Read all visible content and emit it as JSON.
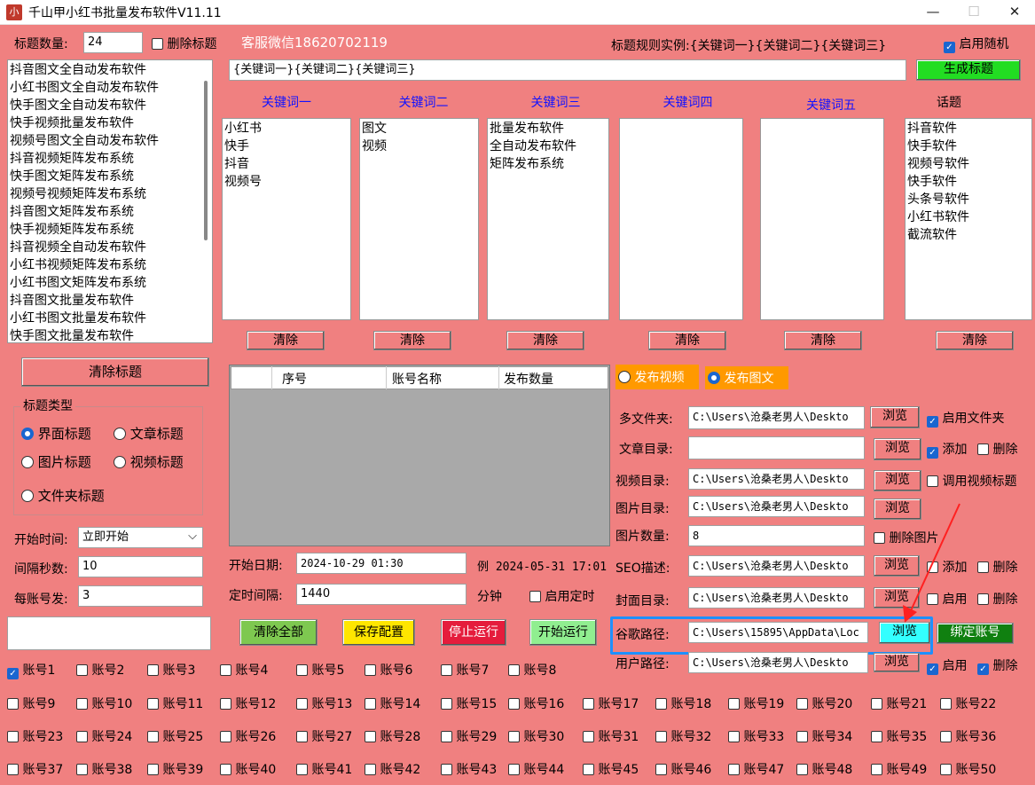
{
  "window": {
    "app_icon": "小",
    "title": "千山甲小红书批量发布软件V11.11"
  },
  "top": {
    "title_count_label": "标题数量:",
    "title_count_value": "24",
    "delete_title_label": "删除标题",
    "service_text": "客服微信18620702119",
    "rule_example": "标题规则实例:{关键词一}{关键词二}{关键词三}",
    "enable_random_label": "启用随机"
  },
  "title_list": [
    "抖音图文全自动发布软件",
    "小红书图文全自动发布软件",
    "快手图文全自动发布软件",
    "快手视频批量发布软件",
    "视频号图文全自动发布软件",
    "抖音视频矩阵发布系统",
    "快手图文矩阵发布系统",
    "视频号视频矩阵发布系统",
    "抖音图文矩阵发布系统",
    "快手视频矩阵发布系统",
    "抖音视频全自动发布软件",
    "小红书视频矩阵发布系统",
    "小红书图文矩阵发布系统",
    "抖音图文批量发布软件",
    "小红书图文批量发布软件",
    "快手图文批量发布软件"
  ],
  "template_input": "{关键词一}{关键词二}{关键词三}",
  "generate_button": "生成标题",
  "keywords": [
    {
      "header": "关键词一",
      "items": [
        "小红书",
        "快手",
        "抖音",
        "视频号"
      ],
      "clear": "清除"
    },
    {
      "header": "关键词二",
      "items": [
        "图文",
        "视频"
      ],
      "clear": "清除"
    },
    {
      "header": "关键词三",
      "items": [
        "批量发布软件",
        "全自动发布软件",
        "矩阵发布系统"
      ],
      "clear": "清除"
    },
    {
      "header": "关键词四",
      "items": [],
      "clear": "清除"
    },
    {
      "header": "关键词五",
      "items": [],
      "clear": "清除"
    },
    {
      "header": "话题",
      "items": [
        "抖音软件",
        "快手软件",
        "视频号软件",
        "快手软件",
        "头条号软件",
        "小红书软件",
        "截流软件"
      ],
      "clear": "清除"
    }
  ],
  "clear_titles_button": "清除标题",
  "title_type": {
    "legend": "标题类型",
    "options": [
      {
        "label": "界面标题",
        "selected": true
      },
      {
        "label": "文章标题",
        "selected": false
      },
      {
        "label": "图片标题",
        "selected": false
      },
      {
        "label": "视频标题",
        "selected": false
      },
      {
        "label": "文件夹标题",
        "selected": false
      }
    ]
  },
  "schedule": {
    "start_time_label": "开始时间:",
    "start_time_value": "立即开始",
    "interval_label": "间隔秒数:",
    "interval_value": "10",
    "per_account_label": "每账号发:",
    "per_account_value": "3"
  },
  "table": {
    "columns": [
      "",
      "序号",
      "账号名称",
      "发布数量"
    ]
  },
  "dates": {
    "start_date_label": "开始日期:",
    "start_date_value": "2024-10-29 01:30",
    "example": "例 2024-05-31 17:01",
    "timer_label": "定时间隔:",
    "timer_value": "1440",
    "minutes_label": "分钟",
    "enable_timer_label": "启用定时"
  },
  "actions": {
    "clear_all": "清除全部",
    "save_config": "保存配置",
    "stop": "停止运行",
    "start": "开始运行"
  },
  "publish_mode": {
    "video": "发布视频",
    "image": "发布图文",
    "selected": "image"
  },
  "paths": {
    "multi_folder_label": "多文件夹:",
    "multi_folder_value": "C:\\Users\\沧桑老男人\\Deskto",
    "enable_folder_label": "启用文件夹",
    "article_dir_label": "文章目录:",
    "article_dir_value": "",
    "add_label": "添加",
    "delete_label": "删除",
    "video_dir_label": "视频目录:",
    "video_dir_value": "C:\\Users\\沧桑老男人\\Deskto",
    "use_video_title_label": "调用视频标题",
    "image_dir_label": "图片目录:",
    "image_dir_value": "C:\\Users\\沧桑老男人\\Deskto",
    "image_count_label": "图片数量:",
    "image_count_value": "8",
    "delete_image_label": "删除图片",
    "seo_label": "SEO描述:",
    "seo_value": "C:\\Users\\沧桑老男人\\Deskto",
    "cover_dir_label": "封面目录:",
    "cover_dir_value": "C:\\Users\\沧桑老男人\\Deskto",
    "enable_label": "启用",
    "chrome_label": "谷歌路径:",
    "chrome_value": "C:\\Users\\15895\\AppData\\Loc",
    "bind_account": "绑定账号",
    "user_label": "用户路径:",
    "user_value": "C:\\Users\\沧桑老男人\\Deskto",
    "browse": "浏览"
  },
  "accounts": [
    "账号1",
    "账号2",
    "账号3",
    "账号4",
    "账号5",
    "账号6",
    "账号7",
    "账号8",
    "账号9",
    "账号10",
    "账号11",
    "账号12",
    "账号13",
    "账号14",
    "账号15",
    "账号16",
    "账号17",
    "账号18",
    "账号19",
    "账号20",
    "账号21",
    "账号22",
    "账号23",
    "账号24",
    "账号25",
    "账号26",
    "账号27",
    "账号28",
    "账号29",
    "账号30",
    "账号31",
    "账号32",
    "账号33",
    "账号34",
    "账号35",
    "账号36",
    "账号37",
    "账号38",
    "账号39",
    "账号40",
    "账号41",
    "账号42",
    "账号43",
    "账号44",
    "账号45",
    "账号46",
    "账号47",
    "账号48",
    "账号49",
    "账号50"
  ],
  "accounts_checked": [
    1
  ],
  "colors": {
    "bg": "#f08080",
    "green": "#22dd22",
    "yellow": "#ffe600",
    "red": "#e51c3c",
    "lightgreen": "#90ee90",
    "orange": "#ff9900",
    "cyan": "#33ffff",
    "darkgreen": "#108010",
    "highlight": "#1e90ff",
    "arrow": "#ff2020"
  }
}
